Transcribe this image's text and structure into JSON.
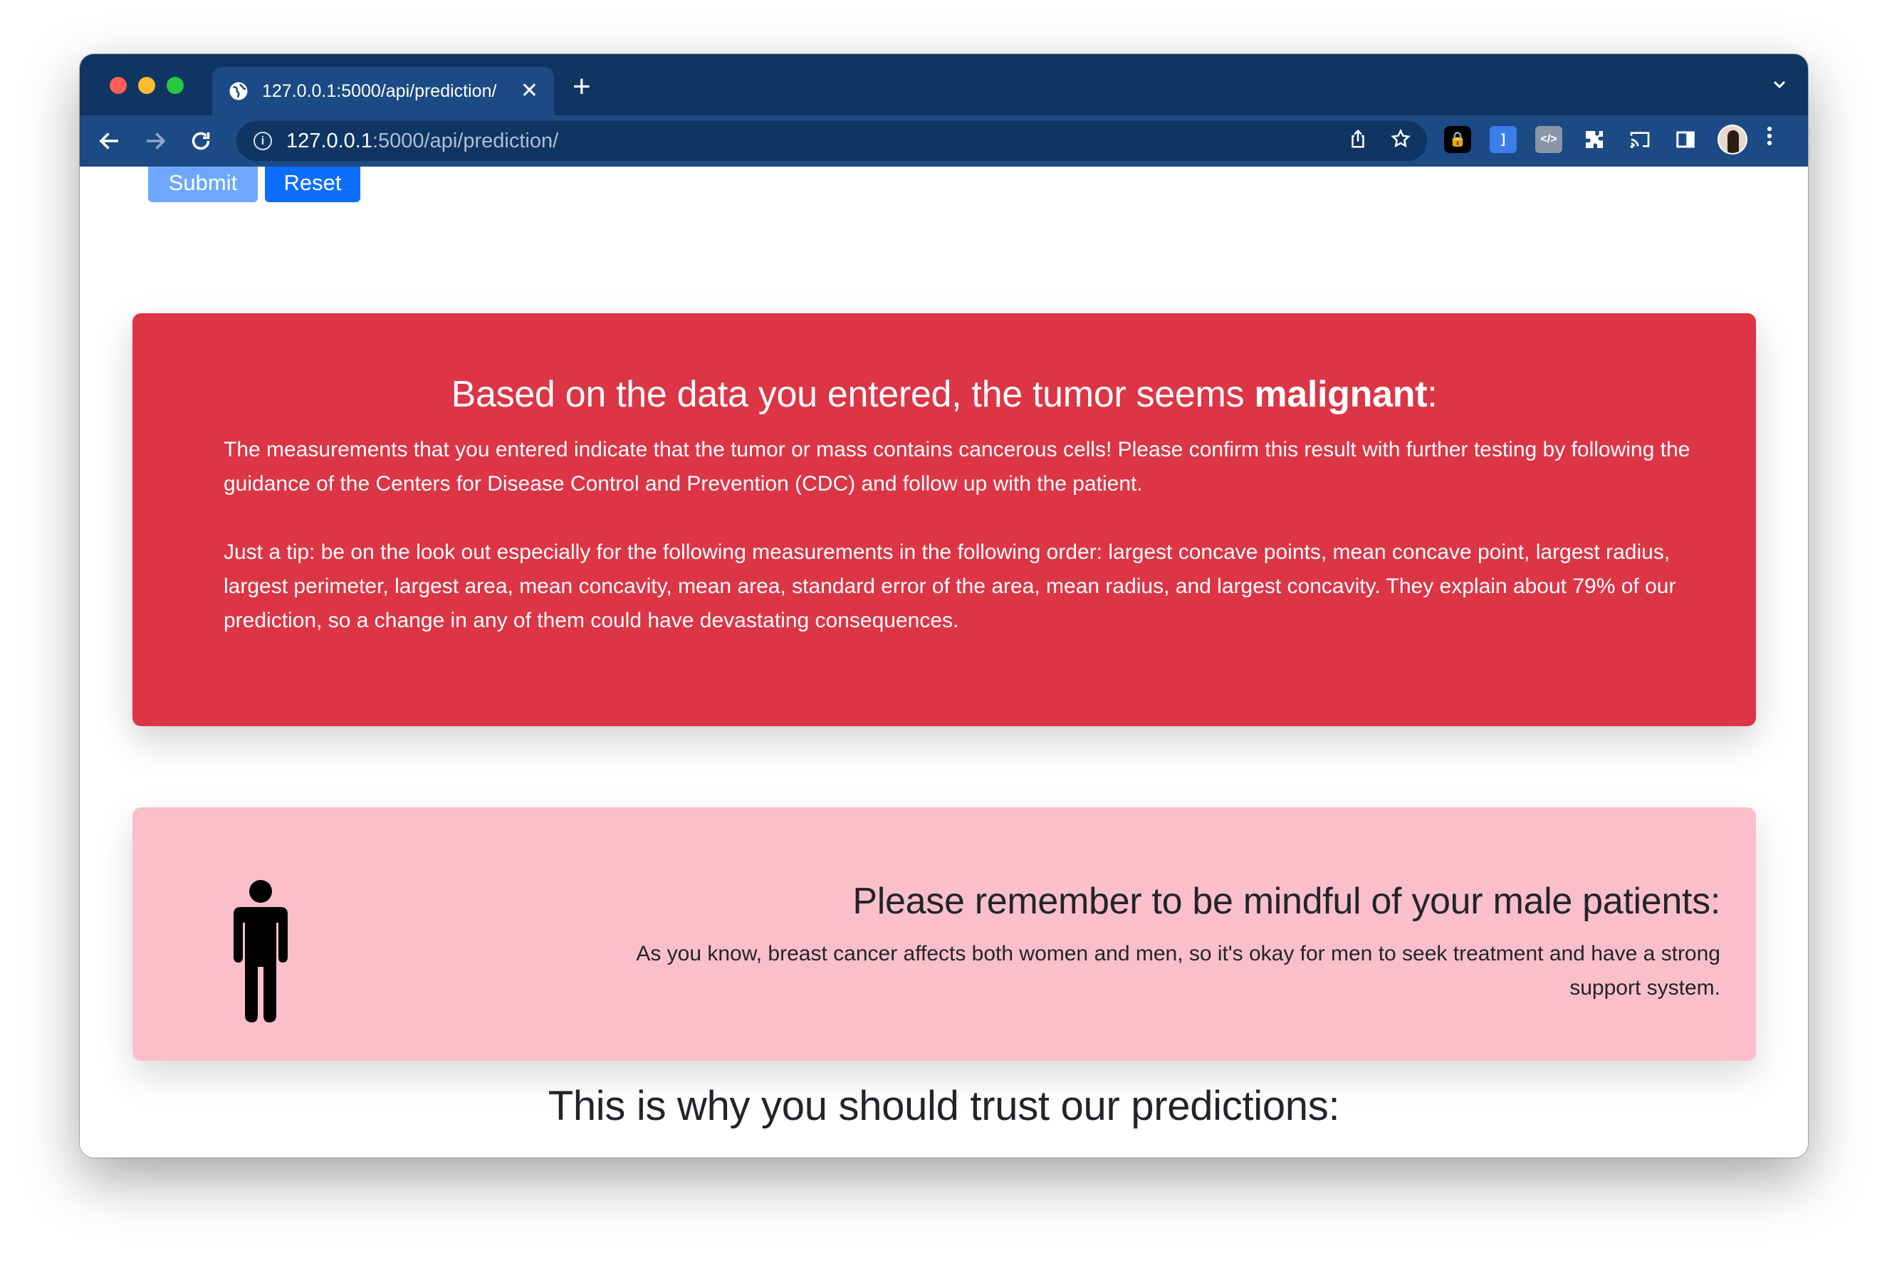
{
  "browser": {
    "tab_title": "127.0.0.1:5000/api/prediction/",
    "tab_close": "✕",
    "new_tab": "+",
    "url_host": "127.0.0.1",
    "url_rest": ":5000/api/prediction/",
    "icons": [
      "back-arrow-icon",
      "forward-arrow-icon",
      "reload-icon",
      "site-info-icon",
      "share-icon",
      "bookmark-star-icon",
      "extension-icon",
      "cast-icon",
      "side-panel-icon",
      "profile-avatar",
      "menu-kebab-icon"
    ]
  },
  "form": {
    "submit_label": "Submit",
    "reset_label": "Reset"
  },
  "result": {
    "heading_prefix": "Based on the data you entered, the tumor seems ",
    "heading_emphasis": "malignant",
    "heading_suffix": ":",
    "paragraph1": "The measurements that you entered indicate that the tumor or mass contains cancerous cells! Please confirm this result with further testing by following the guidance of the Centers for Disease Control and Prevention (CDC) and follow up with the patient.",
    "paragraph2": "Just a tip: be on the look out especially for the following measurements in the following order: largest concave points, mean concave point, largest radius, largest perimeter, largest area, mean concavity, mean area, standard error of the area, mean radius, and largest concavity. They explain about 79% of our prediction, so a change in any of them could have devastating consequences.",
    "color": "#dc3545"
  },
  "male_notice": {
    "heading": "Please remember to be mindful of your male patients:",
    "text": "As you know, breast cancer affects both women and men, so it's okay for men to seek treatment and have a strong support system.",
    "color": "#fbbfcb"
  },
  "trust_heading": "This is why you should trust our predictions:"
}
